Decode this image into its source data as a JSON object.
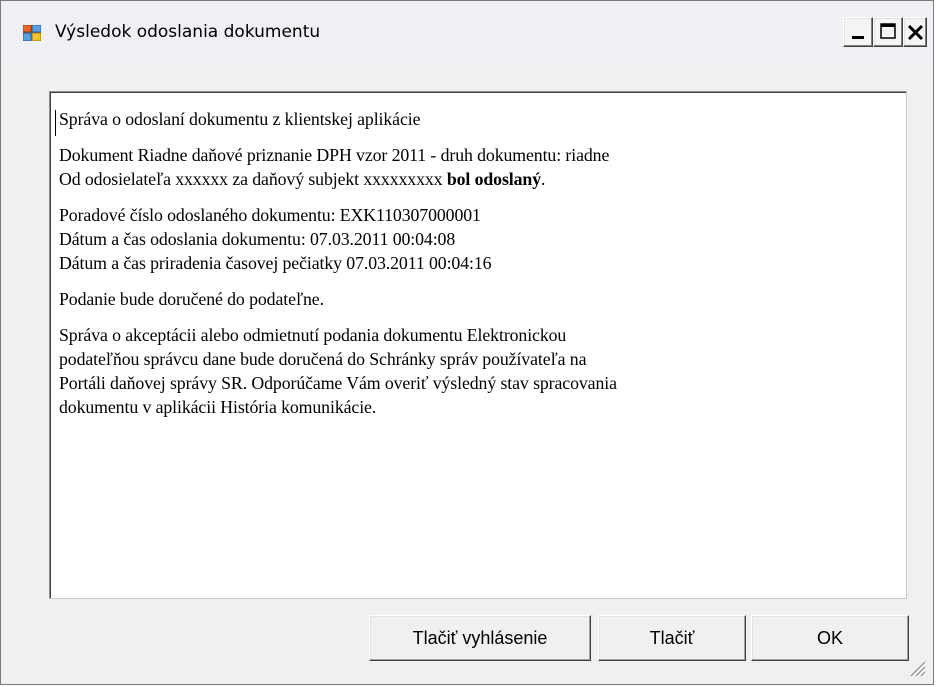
{
  "window": {
    "title": "Výsledok odoslania dokumentu"
  },
  "icons": {
    "app": "window-app-icon",
    "minimize": "minimize-icon",
    "maximize": "maximize-icon",
    "close": "close-icon",
    "grip": "resize-grip-icon"
  },
  "content": {
    "heading": "Správa o odoslaní dokumentu z klientskej aplikácie",
    "document_line": "Dokument Riadne daňové priznanie DPH  vzor 2011 - druh dokumentu: riadne",
    "sender_prefix": "Od odosielateľa  xxxxxx  za daňový subjekt  xxxxxxxxx  ",
    "sender_status": "bol odoslaný",
    "sender_suffix": ".",
    "order_number": "Poradové číslo odoslaného dokumentu: EXK110307000001",
    "sent_datetime": "Dátum a čas odoslania dokumentu: 07.03.2011 00:04:08",
    "stamp_datetime": "Dátum a čas priradenia časovej pečiatky 07.03.2011 00:04:16",
    "delivery_note": "Podanie bude doručené do podateľne.",
    "info_line1": "Správa o akceptácii alebo odmietnutí podania dokumentu Elektronickou",
    "info_line2": "podateľňou správcu dane bude doručená do Schránky správ používateľa na",
    "info_line3": "Portáli daňovej správy SR. Odporúčame Vám overiť výsledný stav spracovania",
    "info_line4": "dokumentu v aplikácii História komunikácie."
  },
  "buttons": {
    "print_declaration": "Tlačiť vyhlásenie",
    "print": "Tlačiť",
    "ok": "OK"
  }
}
